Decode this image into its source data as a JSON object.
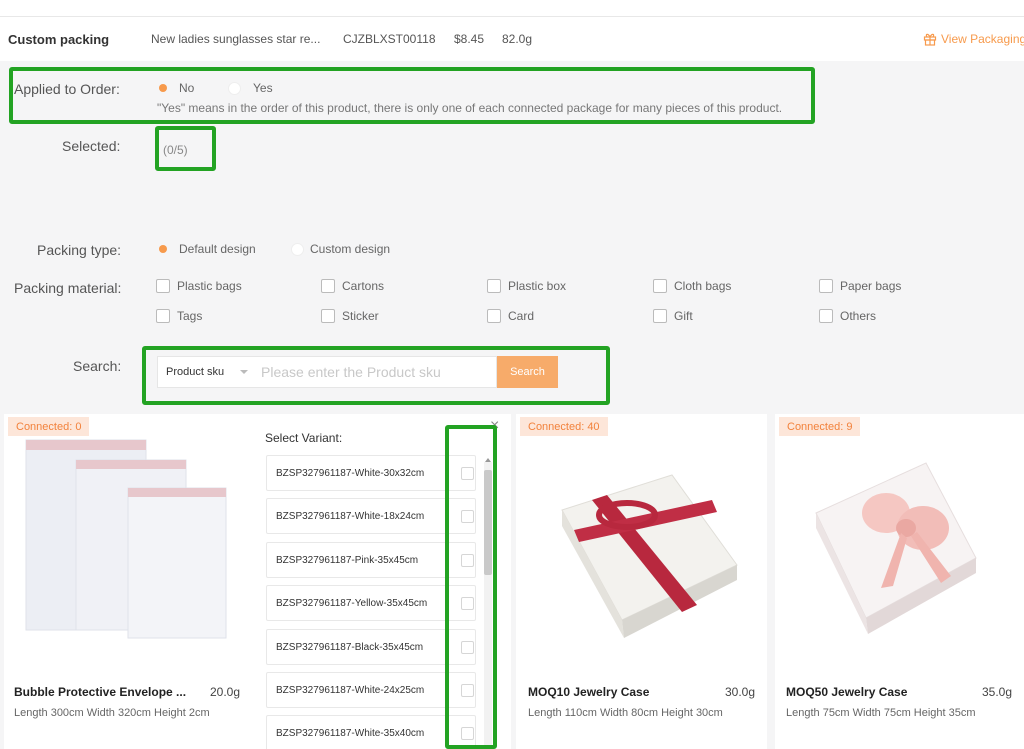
{
  "header": {
    "title": "Custom packing",
    "product_name": "New ladies sunglasses star re...",
    "sku": "CJZBLXST00118",
    "price": "$8.45",
    "weight": "82.0g",
    "view_packaging": "View Packaging"
  },
  "applied": {
    "label": "Applied to Order:",
    "options": [
      "No",
      "Yes"
    ],
    "selected": "No",
    "note": "\"Yes\" means in the order of this product, there is only one of each connected package for many pieces of this product."
  },
  "selected": {
    "label": "Selected:",
    "count": "(0/5)"
  },
  "packing_type": {
    "label": "Packing type:",
    "options": [
      "Default design",
      "Custom design"
    ],
    "selected": "Default design"
  },
  "packing_material": {
    "label": "Packing material:",
    "options": [
      "Plastic bags",
      "Cartons",
      "Plastic box",
      "Cloth bags",
      "Paper bags",
      "Tags",
      "Sticker",
      "Card",
      "Gift",
      "Others"
    ]
  },
  "search": {
    "label": "Search:",
    "select_value": "Product sku",
    "placeholder": "Please enter the Product sku",
    "button": "Search"
  },
  "cards": [
    {
      "badge": "Connected: 0",
      "name": "Bubble Protective Envelope ...",
      "weight": "20.0g",
      "dims": "Length 300cm Width 320cm Height 2cm"
    },
    {
      "badge": "Connected: 40",
      "name": "MOQ10 Jewelry Case",
      "weight": "30.0g",
      "dims": "Length 110cm Width 80cm Height 30cm"
    },
    {
      "badge": "Connected: 9",
      "name": "MOQ50 Jewelry Case",
      "weight": "35.0g",
      "dims": "Length 75cm Width 75cm Height 35cm"
    }
  ],
  "variant_panel": {
    "title": "Select Variant:",
    "close": "×",
    "items": [
      "BZSP327961187-White-30x32cm",
      "BZSP327961187-White-18x24cm",
      "BZSP327961187-Pink-35x45cm",
      "BZSP327961187-Yellow-35x45cm",
      "BZSP327961187-Black-35x45cm",
      "BZSP327961187-White-24x25cm",
      "BZSP327961187-White-35x40cm"
    ]
  },
  "colors": {
    "accent": "#f79a4c",
    "highlight": "#23a323",
    "badge_bg": "#fde6d9"
  },
  "icons": [
    "gift-icon",
    "close-icon",
    "chevron-down-icon"
  ]
}
